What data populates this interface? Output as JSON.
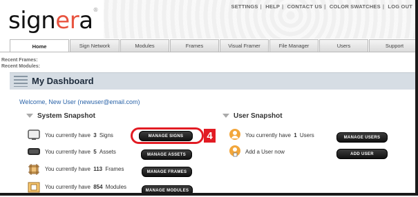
{
  "header": {
    "logo_text_1": "sign",
    "logo_text_2": "er",
    "logo_text_3": "a",
    "links": [
      "SETTINGS",
      "HELP",
      "CONTACT US",
      "COLOR SWATCHES",
      "LOG OUT"
    ],
    "link_separator": "|"
  },
  "tabs": [
    {
      "label": "Home",
      "active": true
    },
    {
      "label": "Sign Network"
    },
    {
      "label": "Modules"
    },
    {
      "label": "Frames"
    },
    {
      "label": "Visual Framer"
    },
    {
      "label": "File Manager"
    },
    {
      "label": "Users"
    },
    {
      "label": "Support"
    }
  ],
  "recent": {
    "frames": "Recent Frames:",
    "modules": "Recent Modules:"
  },
  "dashboard": {
    "title": "My Dashboard",
    "welcome": "Welcome, New User (newuser@email.com)"
  },
  "system": {
    "heading": "System Snapshot",
    "rows": [
      {
        "prefix": "You currently have",
        "count": "3",
        "suffix": "Signs",
        "button": "MANAGE SIGNS",
        "icon": "monitor-icon"
      },
      {
        "prefix": "You currently have",
        "count": "5",
        "suffix": "Assets",
        "button": "MANAGE ASSETS",
        "icon": "asset-icon"
      },
      {
        "prefix": "You currently have",
        "count": "113",
        "suffix": "Frames",
        "button": "MANAGE FRAMES",
        "icon": "frame-icon"
      },
      {
        "prefix": "You currently have",
        "count": "854",
        "suffix": "Modules",
        "button": "MANAGE MODULES",
        "icon": "module-icon"
      }
    ]
  },
  "user": {
    "heading": "User Snapshot",
    "rows": [
      {
        "prefix": "You currently have",
        "count": "1",
        "suffix": "Users",
        "button": "MANAGE USERS",
        "icon": "user-icon"
      },
      {
        "text": "Add a User now",
        "button": "ADD USER",
        "icon": "add-user-icon"
      }
    ]
  },
  "annotation": {
    "step": "4",
    "color": "#e21b23"
  },
  "colors": {
    "accent": "#e8533f",
    "link": "#2a63a8",
    "dashbar": "#d6dde4"
  }
}
